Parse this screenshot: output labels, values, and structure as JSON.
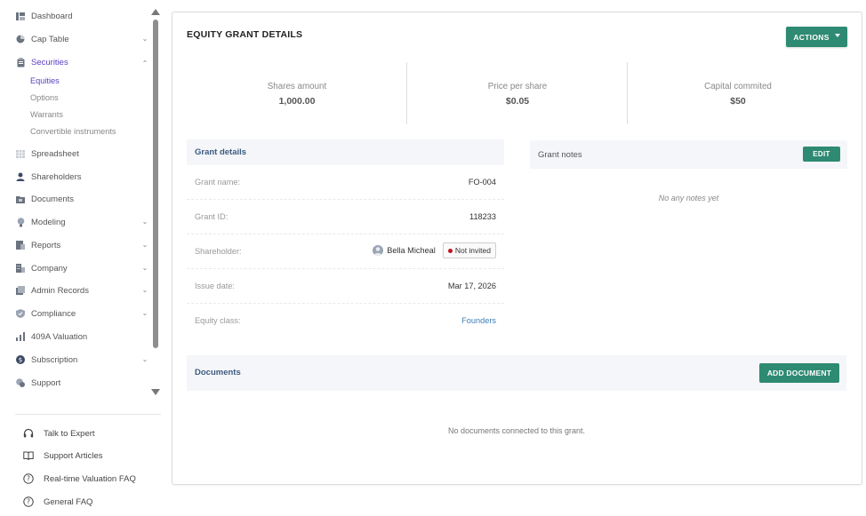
{
  "sidebar": {
    "items": [
      {
        "label": "Dashboard",
        "icon": "dashboard-icon",
        "has_chevron": false
      },
      {
        "label": "Cap Table",
        "icon": "pie-chart-icon",
        "has_chevron": true
      },
      {
        "label": "Securities",
        "icon": "clipboard-icon",
        "has_chevron": true,
        "expanded": true,
        "active": true
      },
      {
        "label": "Spreadsheet",
        "icon": "spreadsheet-icon",
        "has_chevron": false
      },
      {
        "label": "Shareholders",
        "icon": "user-icon",
        "has_chevron": false
      },
      {
        "label": "Documents",
        "icon": "folder-icon",
        "has_chevron": false
      },
      {
        "label": "Modeling",
        "icon": "lightbulb-icon",
        "has_chevron": true
      },
      {
        "label": "Reports",
        "icon": "report-icon",
        "has_chevron": true
      },
      {
        "label": "Company",
        "icon": "building-icon",
        "has_chevron": true
      },
      {
        "label": "Admin Records",
        "icon": "records-icon",
        "has_chevron": true
      },
      {
        "label": "Compliance",
        "icon": "shield-icon",
        "has_chevron": true
      },
      {
        "label": "409A Valuation",
        "icon": "valuation-icon",
        "has_chevron": false
      },
      {
        "label": "Subscription",
        "icon": "dollar-icon",
        "has_chevron": true
      },
      {
        "label": "Support",
        "icon": "support-icon",
        "has_chevron": false
      }
    ],
    "securities_sub": [
      {
        "label": "Equities",
        "active": true
      },
      {
        "label": "Options",
        "active": false
      },
      {
        "label": "Warrants",
        "active": false
      },
      {
        "label": "Convertible instruments",
        "active": false
      }
    ],
    "help": [
      {
        "label": "Talk to Expert",
        "icon": "headset-icon"
      },
      {
        "label": "Support Articles",
        "icon": "book-icon"
      },
      {
        "label": "Real-time Valuation FAQ",
        "icon": "help-circle-icon"
      },
      {
        "label": "General FAQ",
        "icon": "help-circle-icon"
      }
    ]
  },
  "main": {
    "title": "EQUITY GRANT DETAILS",
    "actions_label": "ACTIONS",
    "stats": [
      {
        "label": "Shares amount",
        "value": "1,000.00"
      },
      {
        "label": "Price per share",
        "value": "$0.05"
      },
      {
        "label": "Capital commited",
        "value": "$50"
      }
    ],
    "grant_details": {
      "heading": "Grant details",
      "grant_name_label": "Grant name:",
      "grant_name": "FO-004",
      "grant_id_label": "Grant ID:",
      "grant_id": "118233",
      "shareholder_label": "Shareholder:",
      "shareholder": "Bella Micheal",
      "invite_status": "Not invited",
      "issue_date_label": "Issue date:",
      "issue_date": "Mar 17, 2026",
      "equity_class_label": "Equity class:",
      "equity_class": "Founders"
    },
    "grant_notes": {
      "heading": "Grant notes",
      "edit_label": "EDIT",
      "empty_text": "No any notes yet"
    },
    "documents": {
      "heading": "Documents",
      "add_label": "ADD DOCUMENT",
      "empty_text": "No documents connected to this grant."
    }
  },
  "colors": {
    "accent": "#5b3fc4",
    "button": "#2e8a72",
    "section_bg": "#f4f6f9",
    "status_dot": "#c0141f",
    "link": "#3c7fb8"
  }
}
